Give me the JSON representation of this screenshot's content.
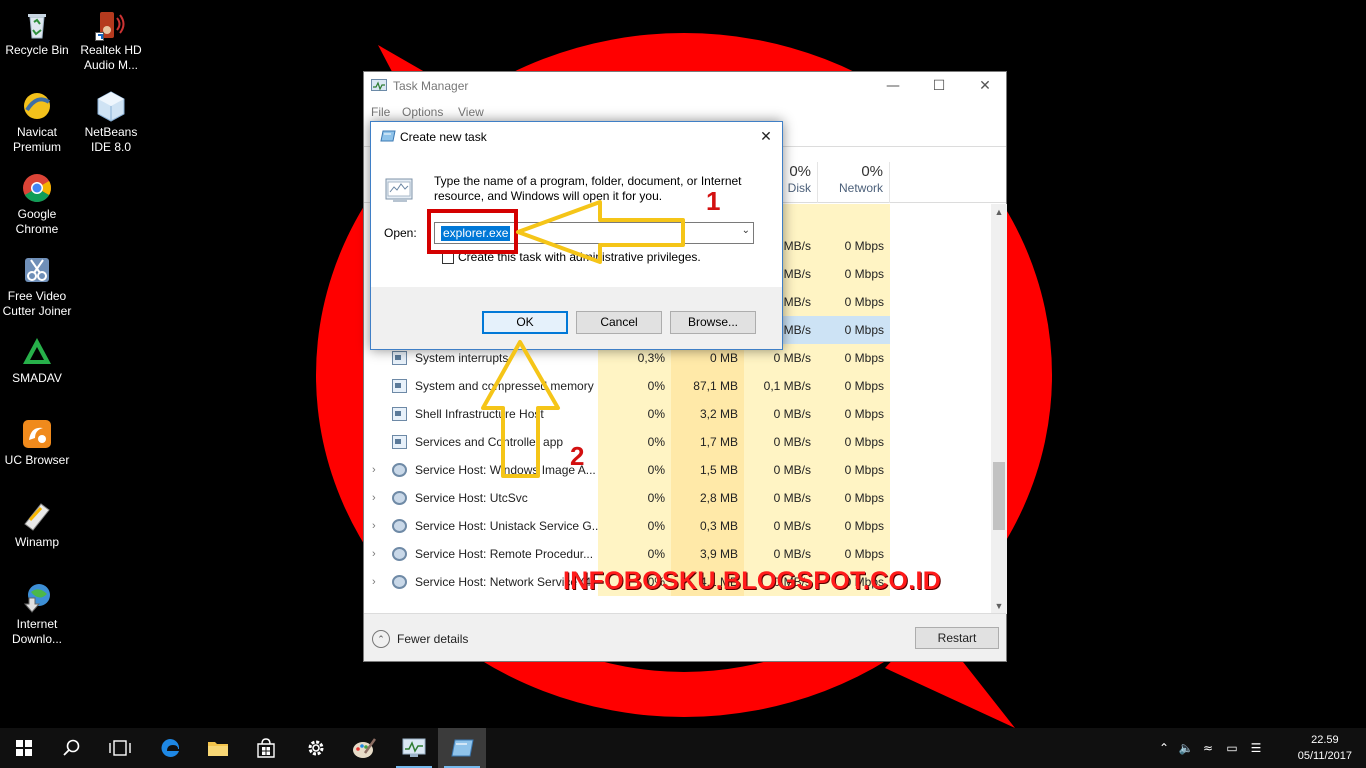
{
  "colors": {
    "wallpaper_red": "#ff0000",
    "accent_blue": "#0078d7",
    "highlight_red": "#d40000",
    "arrow_yellow": "#f5c518",
    "watermark": "#ff1a1a"
  },
  "desktop_icons": [
    {
      "label": "Recycle Bin",
      "icon": "recycle-bin-icon"
    },
    {
      "label": "Realtek HD Audio M...",
      "icon": "speaker-icon"
    },
    {
      "label": "Navicat Premium",
      "icon": "navicat-icon"
    },
    {
      "label": "NetBeans IDE 8.0",
      "icon": "netbeans-cube-icon"
    },
    {
      "label": "Google Chrome",
      "icon": "chrome-icon"
    },
    {
      "label": "Free Video Cutter Joiner",
      "icon": "scissors-icon"
    },
    {
      "label": "SMADAV",
      "icon": "smadav-icon"
    },
    {
      "label": "UC Browser",
      "icon": "uc-browser-icon"
    },
    {
      "label": "Winamp",
      "icon": "winamp-icon"
    },
    {
      "label": "Internet Downlo...",
      "icon": "globe-download-icon"
    }
  ],
  "task_manager": {
    "title": "Task Manager",
    "menu": [
      "File",
      "Options",
      "View"
    ],
    "columns": [
      {
        "pct": "0%",
        "name": "Disk"
      },
      {
        "pct": "0%",
        "name": "Network"
      }
    ],
    "rows": [
      {
        "name": "",
        "cpu": "",
        "mem": "",
        "disk": "",
        "net": "",
        "expander": false,
        "icon": "none"
      },
      {
        "name": "",
        "cpu": "",
        "mem": "",
        "disk": "MB/s",
        "net": "0 Mbps",
        "expander": false,
        "icon": "none"
      },
      {
        "name": "",
        "cpu": "",
        "mem": "",
        "disk": "MB/s",
        "net": "0 Mbps",
        "expander": false,
        "icon": "none"
      },
      {
        "name": "",
        "cpu": "",
        "mem": "",
        "disk": "MB/s",
        "net": "0 Mbps",
        "expander": false,
        "icon": "none"
      },
      {
        "name": "",
        "cpu": "",
        "mem": "",
        "disk": "MB/s",
        "net": "0 Mbps",
        "expander": false,
        "icon": "none",
        "selected": true
      },
      {
        "name": "System interrupts",
        "cpu": "0,3%",
        "mem": "0 MB",
        "disk": "0 MB/s",
        "net": "0 Mbps",
        "expander": false,
        "icon": "sys"
      },
      {
        "name": "System and compressed memory",
        "cpu": "0%",
        "mem": "87,1 MB",
        "disk": "0,1 MB/s",
        "net": "0 Mbps",
        "expander": false,
        "icon": "sys"
      },
      {
        "name": "Shell Infrastructure Host",
        "cpu": "0%",
        "mem": "3,2 MB",
        "disk": "0 MB/s",
        "net": "0 Mbps",
        "expander": false,
        "icon": "sys"
      },
      {
        "name": "Services and Controller app",
        "cpu": "0%",
        "mem": "1,7 MB",
        "disk": "0 MB/s",
        "net": "0 Mbps",
        "expander": false,
        "icon": "sys"
      },
      {
        "name": "Service Host: Windows Image A...",
        "cpu": "0%",
        "mem": "1,5 MB",
        "disk": "0 MB/s",
        "net": "0 Mbps",
        "expander": true,
        "icon": "gear"
      },
      {
        "name": "Service Host: UtcSvc",
        "cpu": "0%",
        "mem": "2,8 MB",
        "disk": "0 MB/s",
        "net": "0 Mbps",
        "expander": true,
        "icon": "gear"
      },
      {
        "name": "Service Host: Unistack Service G...",
        "cpu": "0%",
        "mem": "0,3 MB",
        "disk": "0 MB/s",
        "net": "0 Mbps",
        "expander": true,
        "icon": "gear"
      },
      {
        "name": "Service Host: Remote Procedur...",
        "cpu": "0%",
        "mem": "3,9 MB",
        "disk": "0 MB/s",
        "net": "0 Mbps",
        "expander": true,
        "icon": "gear"
      },
      {
        "name": "Service Host: Network Service (4)",
        "cpu": "0%",
        "mem": "4,1 MB",
        "disk": "0 MB/s",
        "net": "0 Mbps",
        "expander": true,
        "icon": "gear"
      }
    ],
    "fewer_details": "Fewer details",
    "restart": "Restart"
  },
  "dialog": {
    "title": "Create new task",
    "description": "Type the name of a program, folder, document, or Internet resource, and Windows will open it for you.",
    "open_label": "Open:",
    "open_value": "explorer.exe",
    "admin_checkbox": "Create this task with administrative privileges.",
    "ok": "OK",
    "cancel": "Cancel",
    "browse": "Browse..."
  },
  "annotations": {
    "step1": "1",
    "step2": "2",
    "watermark": "INFOBOSKU.BLOGSPOT.CO.ID"
  },
  "taskbar": {
    "apps": [
      "start-windows-icon",
      "search-icon",
      "task-view-icon",
      "edge-icon",
      "file-explorer-icon",
      "store-icon",
      "settings-gear-icon",
      "paint-icon",
      "task-manager-icon",
      "run-dialog-icon"
    ],
    "time": "22.59",
    "date": "05/11/2017"
  }
}
